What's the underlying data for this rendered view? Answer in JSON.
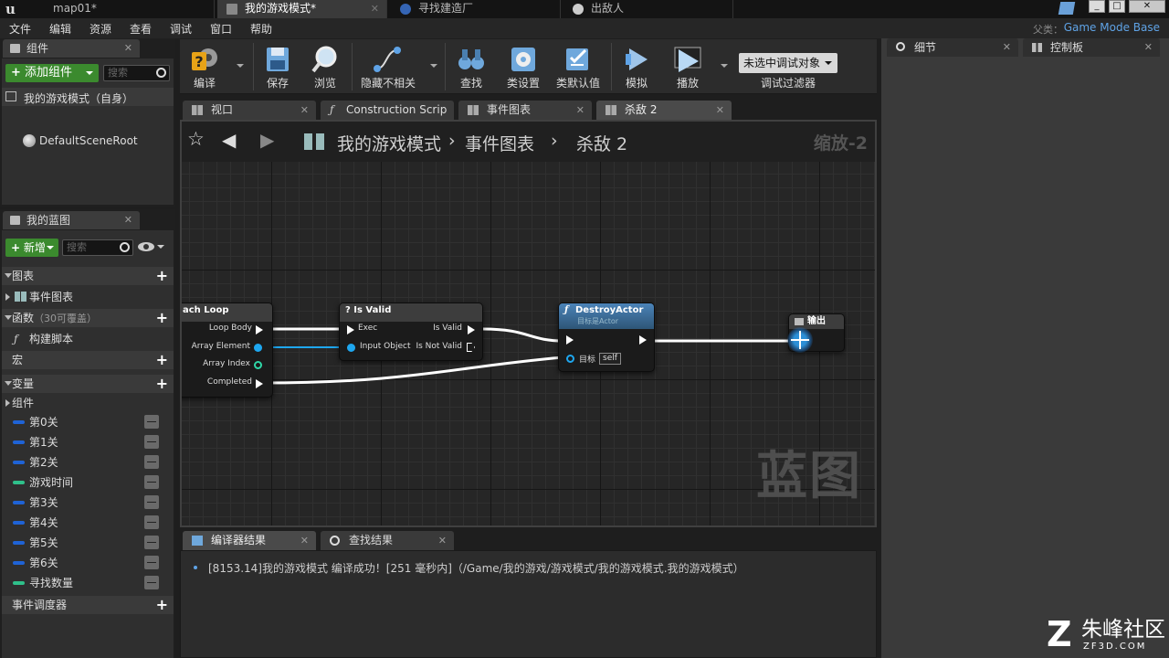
{
  "tabs": [
    {
      "label": "map01*",
      "active": false
    },
    {
      "label": "我的游戏模式*",
      "active": true
    },
    {
      "label": "寻找建造厂",
      "active": false
    },
    {
      "label": "出敌人",
      "active": false
    }
  ],
  "menu": [
    "文件",
    "编辑",
    "资源",
    "查看",
    "调试",
    "窗口",
    "帮助"
  ],
  "parent_class": {
    "label": "父类：",
    "value": "Game Mode Base"
  },
  "components_panel": {
    "title": "组件",
    "add_button": "添加组件",
    "search_placeholder": "搜索",
    "root_item": "我的游戏模式（自身）",
    "child_item": "DefaultSceneRoot"
  },
  "my_blueprint": {
    "title": "我的蓝图",
    "new_button": "新增",
    "search_placeholder": "搜索",
    "sections": {
      "graphs": "图表",
      "event_graph": "事件图表",
      "functions": "函数",
      "functions_note": "（30可覆盖）",
      "construction_script": "构建脚本",
      "macros": "宏",
      "variables": "变量",
      "components_group": "组件",
      "event_dispatchers": "事件调度器"
    },
    "variables": [
      {
        "name": "第0关",
        "color": "#1f63d6"
      },
      {
        "name": "第1关",
        "color": "#1f63d6"
      },
      {
        "name": "第2关",
        "color": "#1f63d6"
      },
      {
        "name": "游戏时间",
        "color": "#2fc08a"
      },
      {
        "name": "第3关",
        "color": "#1f63d6"
      },
      {
        "name": "第4关",
        "color": "#1f63d6"
      },
      {
        "name": "第5关",
        "color": "#1f63d6"
      },
      {
        "name": "第6关",
        "color": "#1f63d6"
      },
      {
        "name": "寻找数量",
        "color": "#2fc08a"
      }
    ]
  },
  "toolbar": {
    "compile": "编译",
    "save": "保存",
    "browse": "浏览",
    "hide_unrelated": "隐藏不相关",
    "find": "查找",
    "class_settings": "类设置",
    "class_defaults": "类默认值",
    "simulate": "模拟",
    "play": "播放",
    "debug_object": "未选中调试对象",
    "debug_filter": "调试过滤器"
  },
  "graph_tabs": [
    {
      "label": "视口",
      "active": false
    },
    {
      "label": "Construction Scrip",
      "active": false
    },
    {
      "label": "事件图表",
      "active": false
    },
    {
      "label": "杀敌 2",
      "active": true
    }
  ],
  "breadcrumb": {
    "root": "我的游戏模式",
    "sep1": "›",
    "graph": "事件图表",
    "sep2": "›",
    "function": "杀敌 2"
  },
  "zoom": "缩放-2",
  "watermark": "蓝图",
  "nodes": {
    "foreach": {
      "title": "ach Loop",
      "loop_body": "Loop Body",
      "array_element": "Array Element",
      "array_index": "Array Index",
      "completed": "Completed"
    },
    "is_valid": {
      "title": "? Is Valid",
      "exec": "Exec",
      "input_object": "Input Object",
      "is_valid": "Is Valid",
      "is_not_valid": "Is Not Valid"
    },
    "destroy": {
      "title": "DestroyActor",
      "subtitle": "目标是Actor",
      "target": "目标",
      "self": "self"
    },
    "output": {
      "title": "输出"
    }
  },
  "colors": {
    "function_node": "#4b83b8",
    "pure_node": "#3d3d3d",
    "exec_wire": "#ffffff",
    "object_pin": "#1ea7f0",
    "int_pin": "#2fd8a8"
  },
  "bottom_tabs": [
    {
      "label": "编译器结果",
      "active": true
    },
    {
      "label": "查找结果",
      "active": false
    }
  ],
  "log": "[8153.14]我的游戏模式 编译成功！[251 毫秒内]（/Game/我的游戏/游戏模式/我的游戏模式.我的游戏模式）",
  "right_panel": {
    "details_tab": "细节",
    "palette_tab": "控制板"
  },
  "site_logo": {
    "name": "朱峰社区",
    "domain": "ZF3D.COM"
  }
}
